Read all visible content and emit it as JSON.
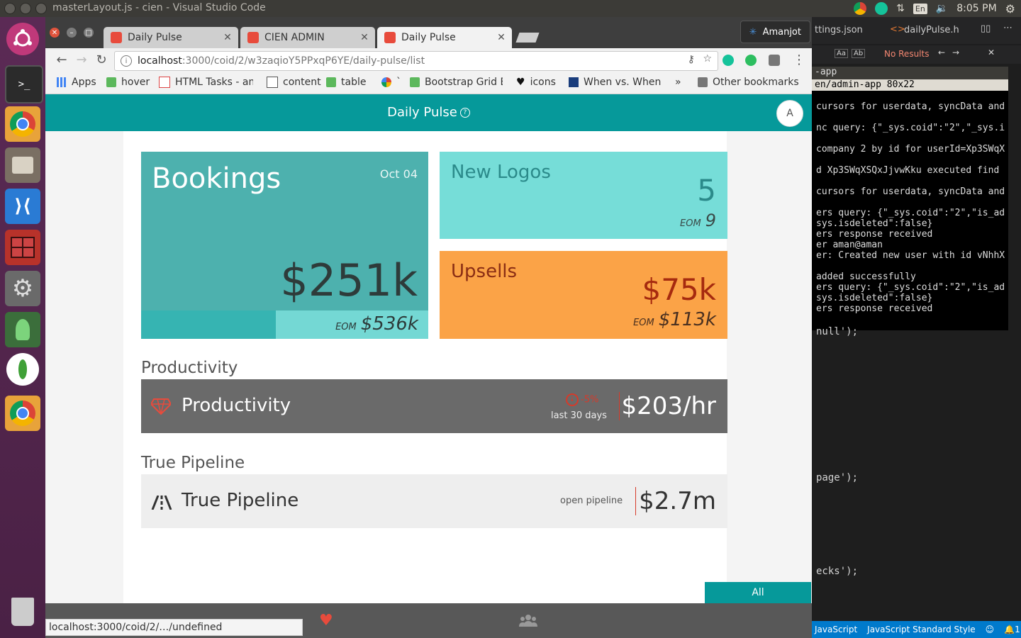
{
  "os": {
    "window_title": "masterLayout.js - cien - Visual Studio Code",
    "clock": "8:05 PM",
    "keyboard": "En"
  },
  "chrome": {
    "tabs": [
      {
        "label": "Daily Pulse",
        "active": false
      },
      {
        "label": "CIEN ADMIN",
        "active": false
      },
      {
        "label": "Daily Pulse",
        "active": true
      }
    ],
    "profile_name": "Amanjot",
    "url_host": "localhost",
    "url_path": ":3000/coid/2/w3zaqioY5PPxqP6YE/daily-pulse/list",
    "bookmarks": [
      {
        "label": "Apps",
        "icon": "apps-grid-icon"
      },
      {
        "label": "hover",
        "icon": "w3-icon"
      },
      {
        "label": "HTML Tasks - am",
        "icon": "gmail-icon"
      },
      {
        "label": "content",
        "icon": "page-icon"
      },
      {
        "label": "table",
        "icon": "w3-icon"
      },
      {
        "label": "`",
        "icon": "google-icon"
      },
      {
        "label": "Bootstrap Grid B",
        "icon": "w3-icon"
      },
      {
        "label": "icons",
        "icon": "heart-icon"
      },
      {
        "label": "When vs. Whene",
        "icon": "site-icon"
      },
      {
        "label": "»",
        "icon": ""
      },
      {
        "label": "Other bookmarks",
        "icon": "folder-icon"
      }
    ],
    "status_url": "localhost:3000/coid/2/…/undefined"
  },
  "app": {
    "title": "Daily Pulse",
    "help": "?",
    "avatar_initial": "A",
    "bookings": {
      "name": "Bookings",
      "date": "Oct 04",
      "value": "$251k",
      "eom_label": "EOM",
      "eom_value": "$536k",
      "progress": 0.47
    },
    "new_logos": {
      "name": "New Logos",
      "value": "5",
      "eom_label": "EOM",
      "eom_value": "9"
    },
    "upsells": {
      "name": "Upsells",
      "value": "$75k",
      "eom_label": "EOM",
      "eom_value": "$113k"
    },
    "productivity": {
      "section": "Productivity",
      "label": "Productivity",
      "change": "-5%",
      "period": "last 30 days",
      "value": "$203/hr"
    },
    "pipeline": {
      "section": "True Pipeline",
      "label": "True Pipeline",
      "sub": "open pipeline",
      "value": "$2.7m"
    },
    "all_button": "All",
    "accent": "#06999a"
  },
  "vscode": {
    "tabs": [
      "ttings.json",
      "dailyPulse.h"
    ],
    "find_status": "No Results",
    "term_title": "-app",
    "term_sub": "en/admin-app 80x22",
    "term_lines": [
      "",
      "cursors for userdata, syncData and",
      "",
      "nc query: {\"_sys.coid\":\"2\",\"_sys.i",
      "",
      "company 2 by id for userId=Xp3SWqX",
      "",
      "d Xp3SWqXSQxJjvwKku executed find",
      "",
      "cursors for userdata, syncData and",
      "",
      "ers query: {\"_sys.coid\":\"2\",\"is_ad",
      "sys.isdeleted\":false}",
      "ers response received",
      "er aman@aman",
      "er: Created new user with id vNhhX",
      "",
      "added successfully",
      "ers query: {\"_sys.coid\":\"2\",\"is_ad",
      "sys.isdeleted\":false}",
      "ers response received"
    ],
    "code_lines": [
      "null');",
      "page');",
      "ecks');"
    ],
    "status": [
      "JavaScript",
      "JavaScript Standard Style",
      "1"
    ]
  }
}
